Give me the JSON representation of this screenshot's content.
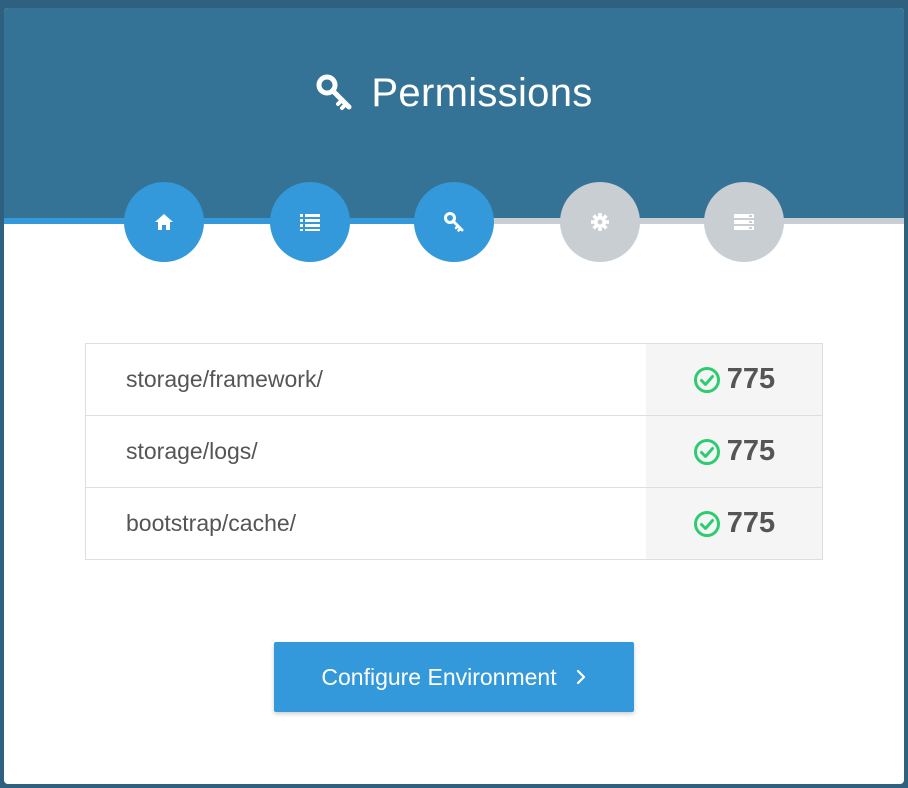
{
  "header": {
    "title": "Permissions",
    "icon": "key-icon",
    "background": "#357396"
  },
  "steps": [
    {
      "icon": "home-icon",
      "state": "done"
    },
    {
      "icon": "list-icon",
      "state": "done"
    },
    {
      "icon": "key-icon",
      "state": "current"
    },
    {
      "icon": "gear-icon",
      "state": "pending"
    },
    {
      "icon": "server-icon",
      "state": "pending"
    }
  ],
  "permissions": {
    "rows": [
      {
        "path": "storage/framework/",
        "value": "775",
        "status": "ok"
      },
      {
        "path": "storage/logs/",
        "value": "775",
        "status": "ok"
      },
      {
        "path": "bootstrap/cache/",
        "value": "775",
        "status": "ok"
      }
    ]
  },
  "button": {
    "label": "Configure Environment",
    "icon": "chevron-right-icon"
  },
  "colors": {
    "accent": "#3399db",
    "inactive": "#c9ced2",
    "success": "#2ecc71",
    "text": "#555555"
  }
}
